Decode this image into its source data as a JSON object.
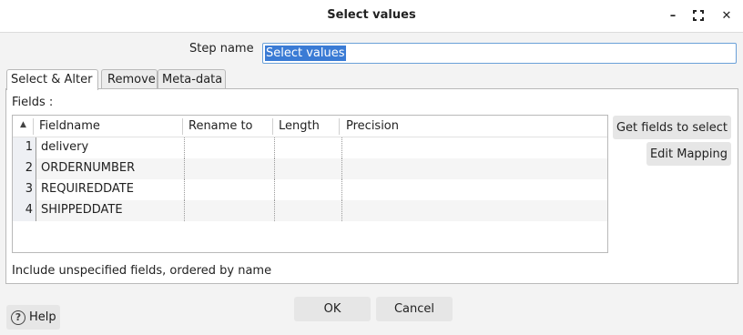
{
  "window": {
    "title": "Select values",
    "minimize_glyph": "–",
    "close_glyph": "✕"
  },
  "step_name": {
    "label": "Step name",
    "value": "Select values"
  },
  "tabs": [
    {
      "label": "Select & Alter",
      "active": true
    },
    {
      "label": "Remove",
      "active": false
    },
    {
      "label": "Meta-data",
      "active": false
    }
  ],
  "fields": {
    "label": "Fields :",
    "columns": [
      "Fieldname",
      "Rename to",
      "Length",
      "Precision"
    ],
    "sort_glyph": "▲",
    "rows": [
      {
        "num": "1",
        "fieldname": "delivery",
        "rename": "",
        "length": "",
        "precision": ""
      },
      {
        "num": "2",
        "fieldname": "ORDERNUMBER",
        "rename": "",
        "length": "",
        "precision": ""
      },
      {
        "num": "3",
        "fieldname": "REQUIREDDATE",
        "rename": "",
        "length": "",
        "precision": ""
      },
      {
        "num": "4",
        "fieldname": "SHIPPEDDATE",
        "rename": "",
        "length": "",
        "precision": ""
      }
    ]
  },
  "side_buttons": {
    "get_fields": "Get fields to select",
    "edit_mapping": "Edit Mapping"
  },
  "include_unspecified": "Include unspecified fields, ordered by name",
  "footer": {
    "ok": "OK",
    "cancel": "Cancel",
    "help": "Help",
    "help_icon_glyph": "?"
  },
  "colors": {
    "accent": "#3a7bd5",
    "selection_text": "#ffffff"
  }
}
